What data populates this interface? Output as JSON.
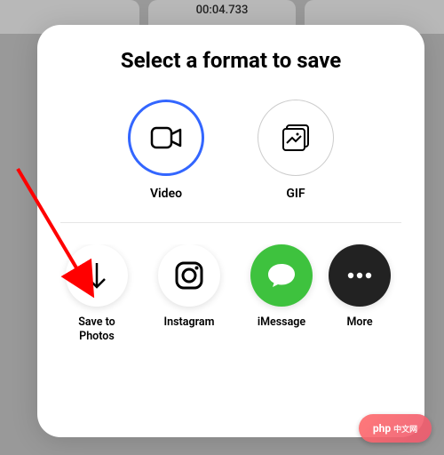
{
  "timestamp": "00:04.733",
  "sheet": {
    "title": "Select a format to save",
    "formats": [
      {
        "label": "Video",
        "selected": true
      },
      {
        "label": "GIF",
        "selected": false
      }
    ],
    "share_targets": [
      {
        "label": "Save to\nPhotos"
      },
      {
        "label": "Instagram"
      },
      {
        "label": "iMessage"
      },
      {
        "label": "More"
      }
    ]
  },
  "colors": {
    "accent": "#3366ff",
    "imessage": "#3ec23e"
  },
  "watermark": {
    "text": "php",
    "sub": "中文网"
  }
}
